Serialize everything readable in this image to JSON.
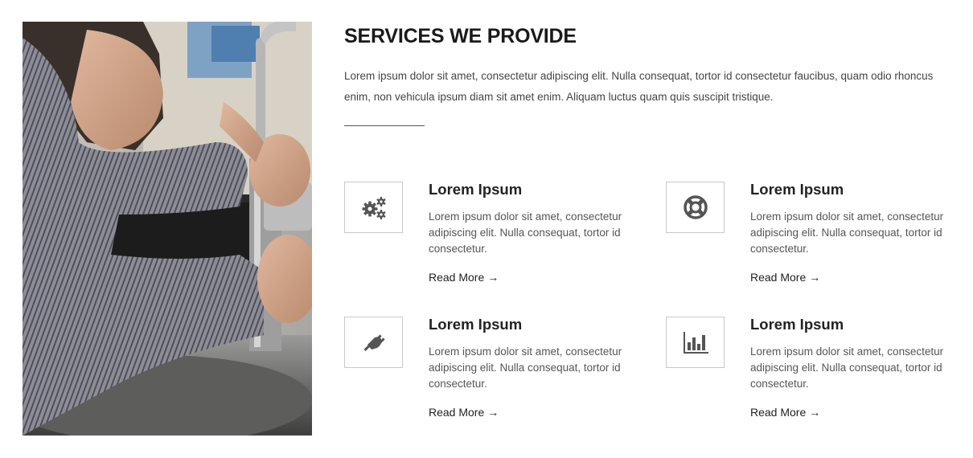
{
  "section": {
    "title": "SERVICES WE PROVIDE",
    "intro": "Lorem ipsum dolor sit amet, consectetur adipiscing elit. Nulla consequat, tortor id consectetur faucibus, quam odio rhoncus enim, non vehicula ipsum diam sit amet enim. Aliquam luctus quam quis suscipit tristique."
  },
  "photo": {
    "subject": "plumber-fixing-faucet-photo"
  },
  "services": [
    {
      "icon": "gears-icon",
      "title": "Lorem Ipsum",
      "text": "Lorem ipsum dolor sit amet, consectetur adipiscing elit. Nulla consequat, tortor id consectetur.",
      "link": "Read More",
      "arrow": "→"
    },
    {
      "icon": "life-ring-icon",
      "title": "Lorem Ipsum",
      "text": "Lorem ipsum dolor sit amet, consectetur adipiscing elit. Nulla consequat, tortor id consectetur.",
      "link": "Read More",
      "arrow": "→"
    },
    {
      "icon": "plug-icon",
      "title": "Lorem Ipsum",
      "text": "Lorem ipsum dolor sit amet, consectetur adipiscing elit. Nulla consequat, tortor id consectetur.",
      "link": "Read More",
      "arrow": "→"
    },
    {
      "icon": "bar-chart-icon",
      "title": "Lorem Ipsum",
      "text": "Lorem ipsum dolor sit amet, consectetur adipiscing elit. Nulla consequat, tortor id consectetur.",
      "link": "Read More",
      "arrow": "→"
    }
  ],
  "colors": {
    "icon": "#555555",
    "border": "#c9c9c9",
    "heading": "#1a1a1a"
  }
}
